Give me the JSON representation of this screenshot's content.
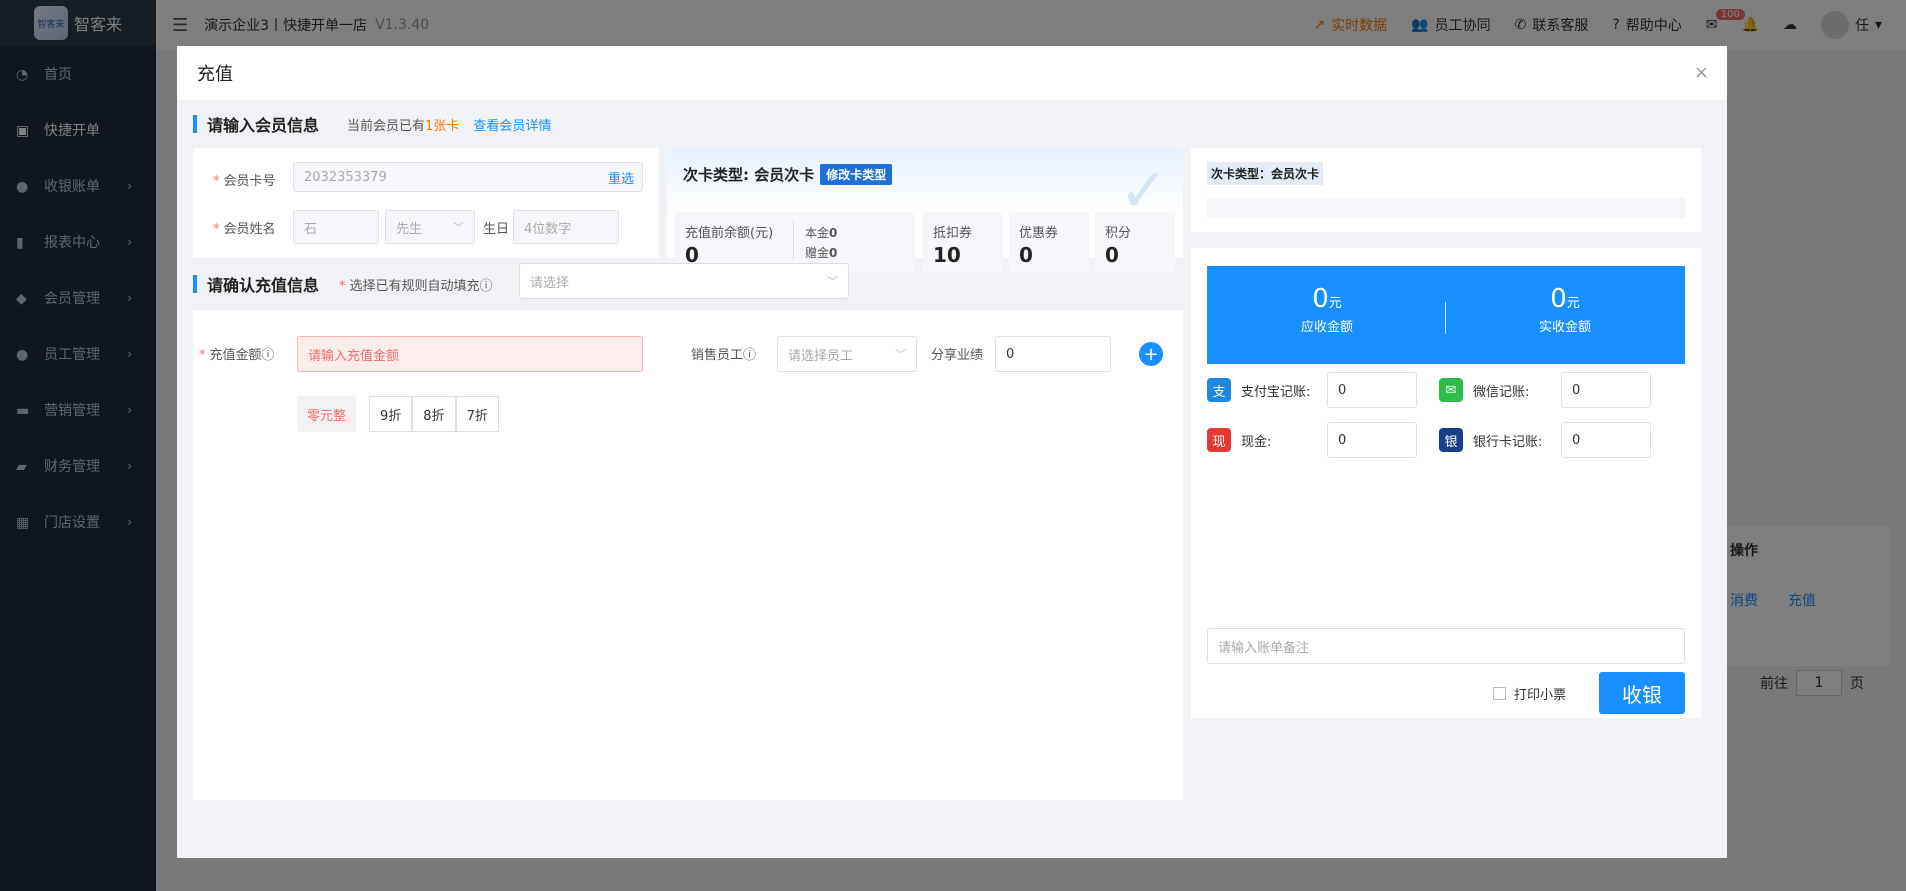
{
  "app": {
    "logo_mark_text": "智客来",
    "logo_text": "智客来",
    "breadcrumb": "演示企业3丨快捷开单一店",
    "version": "V1.3.40"
  },
  "sidebar": {
    "items": [
      {
        "label": "首页"
      },
      {
        "label": "快捷开单"
      },
      {
        "label": "收银账单"
      },
      {
        "label": "报表中心"
      },
      {
        "label": "会员管理"
      },
      {
        "label": "员工管理"
      },
      {
        "label": "营销管理"
      },
      {
        "label": "财务管理"
      },
      {
        "label": "门店设置"
      }
    ]
  },
  "header": {
    "realtime": "实时数据",
    "staff_collab": "员工协同",
    "contact": "联系客服",
    "help": "帮助中心",
    "mail_badge": "100",
    "user": "任"
  },
  "background": {
    "op_header": "操作",
    "link_consume": "消费",
    "link_recharge": "充值",
    "goto": "前往",
    "page_num": "1",
    "page_unit": "页"
  },
  "modal": {
    "title": "充值",
    "close": "×",
    "member_section": {
      "title": "请输入会员信息",
      "current_prefix": "当前会员已有",
      "cards_count": "1张卡",
      "view_detail": "查看会员详情",
      "card_no_label": "会员卡号",
      "card_no_value": "2032353379",
      "reselect": "重选",
      "name_label": "会员姓名",
      "name_value": "石",
      "gender_value": "先生",
      "birthday_label": "生日",
      "birthday_placeholder": "4位数字"
    },
    "card_info": {
      "type_label": "次卡类型: 会员次卡",
      "modify_btn": "修改卡类型",
      "balance_label": "充值前余额(元)",
      "balance_value": "0",
      "principal_label": "本金",
      "principal_value": "0",
      "gift_label": "赠金",
      "gift_value": "0",
      "deduct_label": "抵扣券",
      "deduct_value": "10",
      "coupon_label": "优惠券",
      "coupon_value": "0",
      "points_label": "积分",
      "points_value": "0"
    },
    "right_top": {
      "type_tag": "次卡类型：会员次卡"
    },
    "recharge_section": {
      "title": "请确认充值信息",
      "rule_label": "选择已有规则自动填充",
      "rule_placeholder": "请选择",
      "amount_label": "充值金额",
      "amount_placeholder": "请输入充值金额",
      "sales_label": "销售员工",
      "sales_placeholder": "请选择员工",
      "share_label": "分享业绩",
      "share_value": "0",
      "zero_btn": "零元整",
      "discounts": [
        "9折",
        "8折",
        "7折"
      ]
    },
    "payment": {
      "receivable_value": "0",
      "receivable_unit": "元",
      "receivable_label": "应收金额",
      "received_value": "0",
      "received_unit": "元",
      "received_label": "实收金额",
      "alipay_label": "支付宝记账:",
      "alipay_value": "0",
      "wechat_label": "微信记账:",
      "wechat_value": "0",
      "cash_label": "现金:",
      "cash_value": "0",
      "bank_label": "银行卡记账:",
      "bank_value": "0",
      "remark_placeholder": "请输入账单备注",
      "print_label": "打印小票",
      "checkout_btn": "收银"
    }
  },
  "colors": {
    "primary": "#1890ff",
    "accent_orange": "#ff7a00",
    "error": "#f56c6c",
    "sidebar_bg": "#1f2d3d"
  }
}
